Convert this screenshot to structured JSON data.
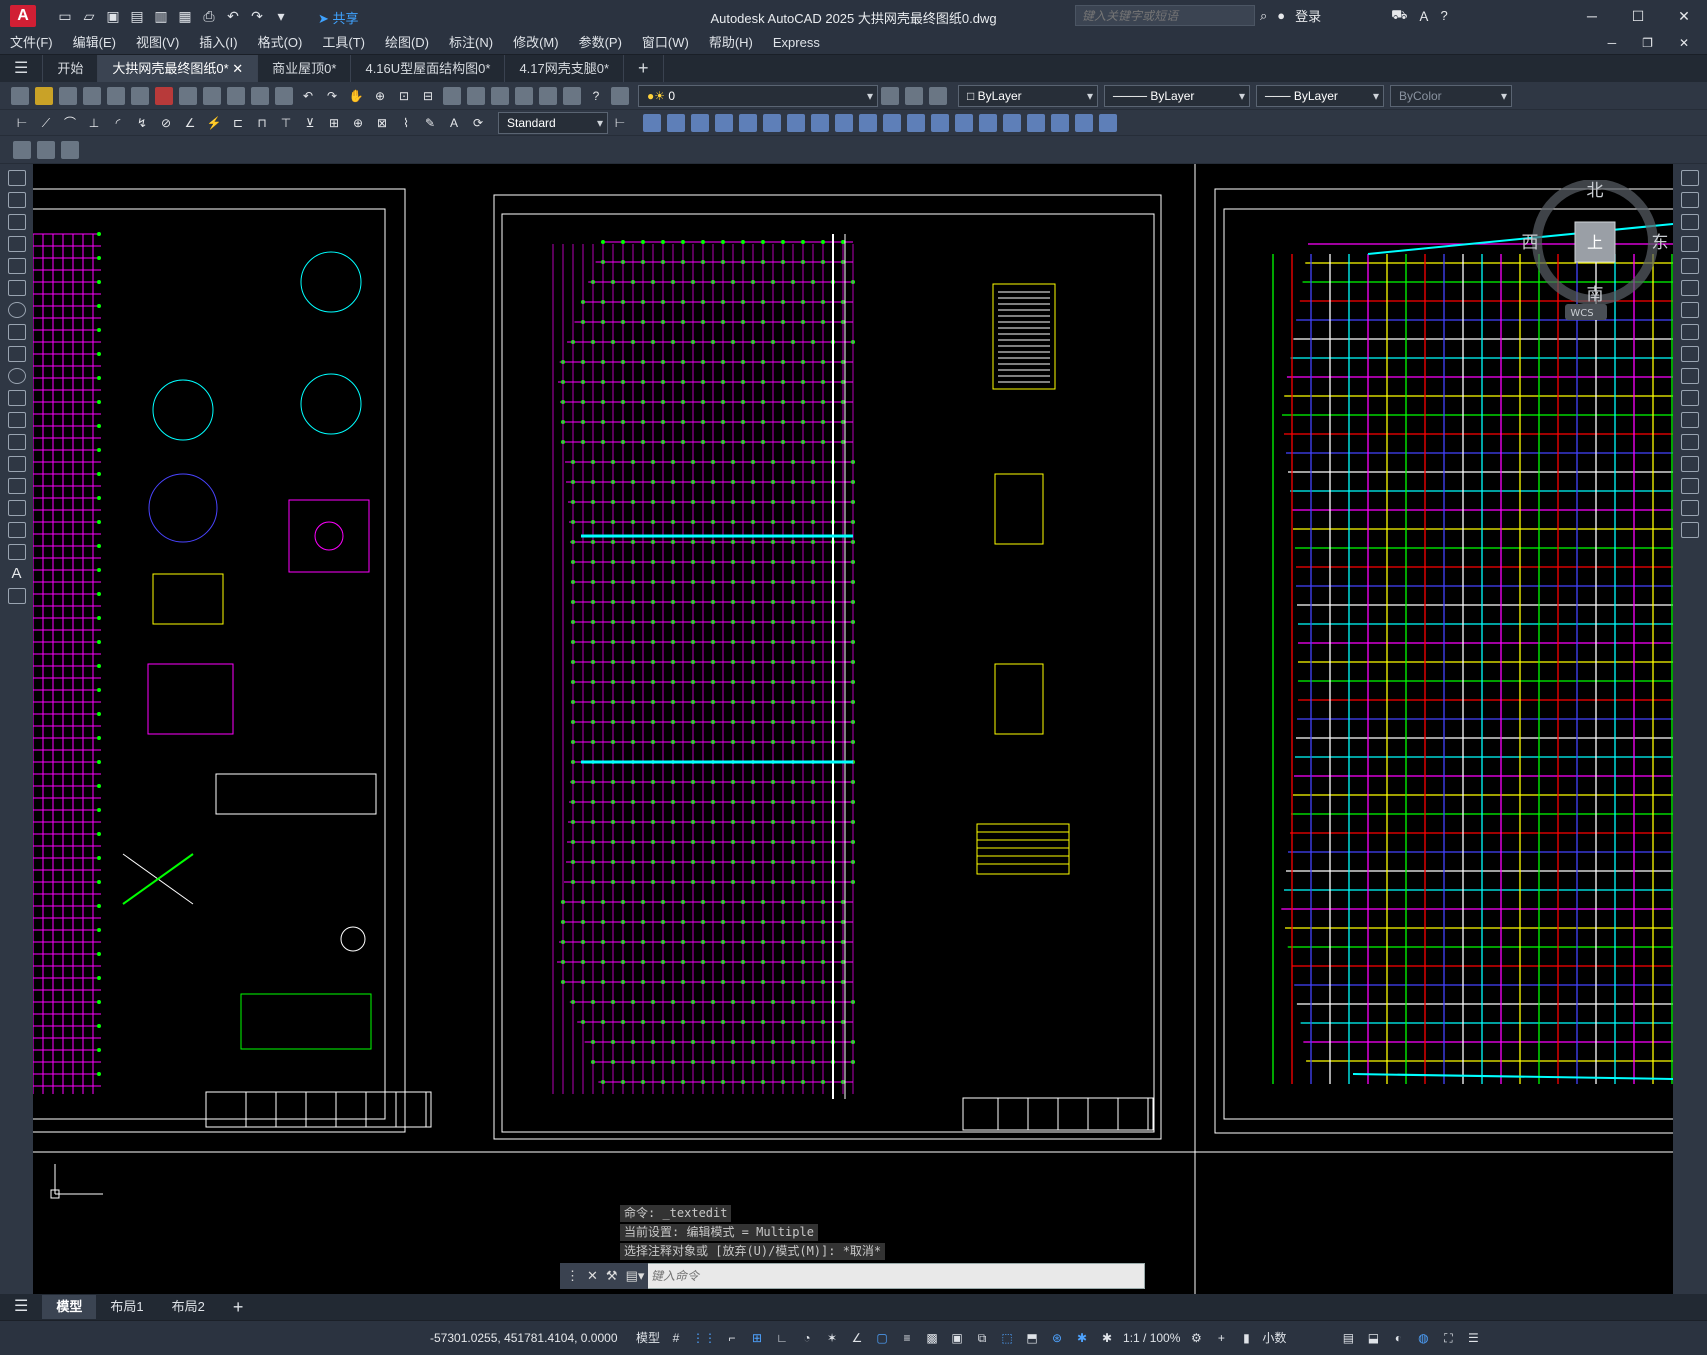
{
  "app": {
    "logo_letter": "A",
    "window_title": "Autodesk AutoCAD 2025    大拱网壳最终图纸0.dwg",
    "search_placeholder": "键入关键字或短语",
    "login_label": "登录",
    "share_label": "共享",
    "qat_icons": [
      "new-icon",
      "open-icon",
      "save-icon",
      "saveas-icon",
      "open-web-icon",
      "save-web-icon",
      "plot-icon",
      "undo-icon",
      "redo-icon",
      "workspace-icon"
    ]
  },
  "menu": [
    "文件(F)",
    "编辑(E)",
    "视图(V)",
    "插入(I)",
    "格式(O)",
    "工具(T)",
    "绘图(D)",
    "标注(N)",
    "修改(M)",
    "参数(P)",
    "窗口(W)",
    "帮助(H)",
    "Express"
  ],
  "doc_tabs": [
    {
      "label": "开始",
      "active": false
    },
    {
      "label": "大拱网壳最终图纸0*",
      "active": true
    },
    {
      "label": "商业屋顶0*",
      "active": false
    },
    {
      "label": "4.16U型屋面结构图0*",
      "active": false
    },
    {
      "label": "4.17网壳支腿0*",
      "active": false
    }
  ],
  "toolbar": {
    "layer_value": "0",
    "color_value": "ByLayer",
    "linetype_value": "ByLayer",
    "lineweight_value": "ByLayer",
    "plotstyle_value": "ByColor",
    "dimstyle_value": "Standard"
  },
  "viewcube": {
    "north": "北",
    "south": "南",
    "east": "东",
    "west": "西",
    "top": "上",
    "wcs": "WCS"
  },
  "command": {
    "history": [
      "命令: _textedit",
      "当前设置: 编辑模式 = Multiple",
      "选择注释对象或 [放弃(U)/模式(M)]: *取消*"
    ],
    "placeholder": "键入命令"
  },
  "layout_tabs": [
    {
      "label": "模型",
      "active": true
    },
    {
      "label": "布局1",
      "active": false
    },
    {
      "label": "布局2",
      "active": false
    }
  ],
  "status": {
    "coords": "-57301.0255, 451781.4104, 0.0000",
    "model_label": "模型",
    "scale": "1:1 / 100%",
    "units": "小数"
  },
  "colors": {
    "grid_magenta": "#ff00ff",
    "grid_green": "#00ff00",
    "frame": "#ffffff",
    "cyan": "#00ffff",
    "yellow": "#ffff00",
    "red": "#ff0000"
  }
}
